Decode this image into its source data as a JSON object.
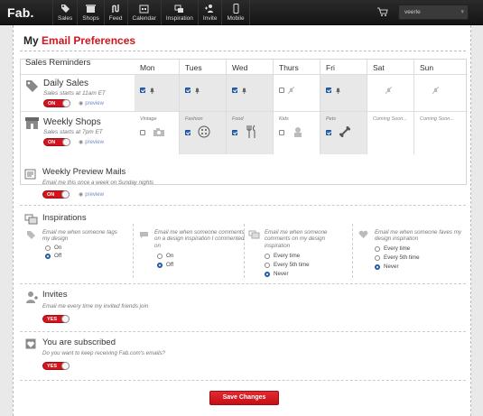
{
  "topbar": {
    "logo": "Fab.",
    "nav": [
      {
        "label": "Sales",
        "icon": "tag-icon"
      },
      {
        "label": "Shops",
        "icon": "shop-icon"
      },
      {
        "label": "Feed",
        "icon": "feed-icon"
      },
      {
        "label": "Calendar",
        "icon": "calendar-icon"
      },
      {
        "label": "Inspiration",
        "icon": "inspiration-icon"
      },
      {
        "label": "Invite",
        "icon": "invite-icon"
      },
      {
        "label": "Mobile",
        "icon": "mobile-icon"
      }
    ],
    "user_name": "veerle"
  },
  "page": {
    "title_prefix": "My",
    "title_accent": "Email Preferences",
    "accent_color": "#d4141c"
  },
  "sales_reminders": {
    "title": "Sales Reminders",
    "days": [
      "Mon",
      "Tues",
      "Wed",
      "Thurs",
      "Fri",
      "Sat",
      "Sun"
    ],
    "daily_sales": {
      "title": "Daily Sales",
      "subtitle": "Sales starts at 11am ET",
      "toggle": "ON",
      "preview": "preview",
      "days_checked": [
        true,
        true,
        true,
        false,
        true,
        false,
        false
      ]
    },
    "weekly_shops": {
      "title": "Weekly Shops",
      "subtitle": "Sales starts at 7pm ET",
      "toggle": "ON",
      "preview": "preview",
      "categories": [
        "Vintage",
        "Fashion",
        "Food",
        "Kids",
        "Pets",
        "Coming Soon...",
        "Coming Soon..."
      ],
      "checked": [
        false,
        true,
        true,
        false,
        true,
        false,
        false
      ]
    }
  },
  "weekly_preview": {
    "title": "Weekly Preview Mails",
    "subtitle": "Email me this once a week on Sunday nights",
    "toggle": "ON",
    "preview": "preview"
  },
  "inspirations": {
    "title": "Inspirations",
    "columns": [
      {
        "text": "Email me when someone tags my design",
        "options": [
          "On",
          "Off"
        ],
        "selected": 1
      },
      {
        "text": "Email me when someone comments on a design inspiration I commented on",
        "options": [
          "On",
          "Off"
        ],
        "selected": 1
      },
      {
        "text": "Email me when someone comments on my design inspiration",
        "options": [
          "Every time",
          "Every 5th time",
          "Never"
        ],
        "selected": 2
      },
      {
        "text": "Email me when someone faves my design inspiration",
        "options": [
          "Every time",
          "Every 5th time",
          "Never"
        ],
        "selected": 2
      }
    ]
  },
  "invites": {
    "title": "Invites",
    "subtitle": "Email me every time my invited friends join",
    "toggle": "YES"
  },
  "subscribed": {
    "title": "You are subscribed",
    "subtitle": "Do you want to keep receiving Fab.com's emails?",
    "toggle": "YES"
  },
  "save_label": "Save Changes"
}
